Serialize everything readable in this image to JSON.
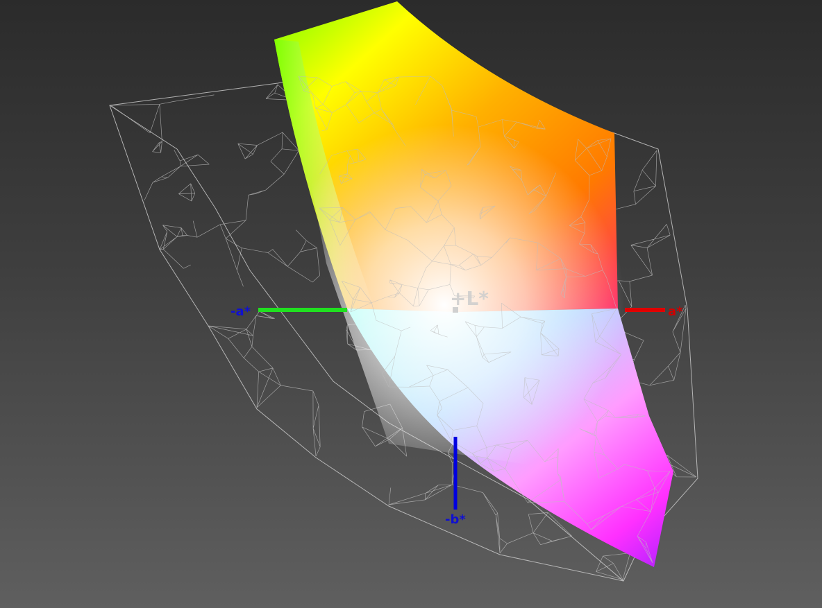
{
  "axes": {
    "l_plus": "+L*",
    "a_minus": "-a*",
    "a_plus": "a*",
    "b_minus": "-b*"
  },
  "colors": {
    "background_top": "#2b2b2b",
    "background_bottom": "#5f5f5f",
    "wireframe": "#c8c8c8",
    "axis_green": "#20e020",
    "axis_red": "#e00000",
    "axis_blue": "#0000e0",
    "axis_label_blue": "#1010d0",
    "axis_label_red": "#d00000",
    "axis_label_light": "#c8c8c8",
    "gamut_yellow": "#ffff00",
    "gamut_green": "#7cff00",
    "gamut_orange": "#ff7a00",
    "gamut_magenta": "#ff30ff",
    "gamut_purple": "#b020ff",
    "gamut_cyan": "#8ffff0",
    "gamut_white": "#ffffff"
  }
}
